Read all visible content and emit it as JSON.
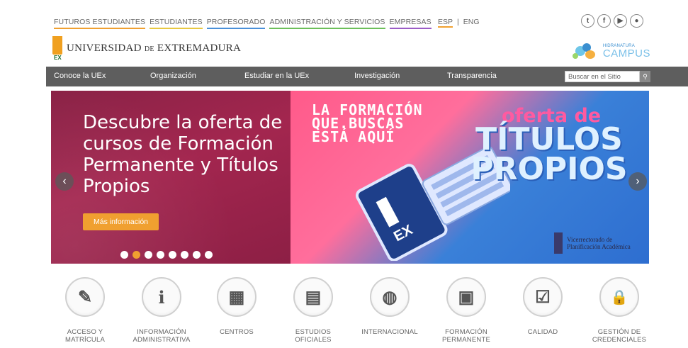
{
  "top_links": [
    {
      "label": "FUTUROS ESTUDIANTES",
      "accent": "#f0a030"
    },
    {
      "label": "ESTUDIANTES",
      "accent": "#e8c840"
    },
    {
      "label": "PROFESORADO",
      "accent": "#4a90d9"
    },
    {
      "label": "ADMINISTRACIÓN Y SERVICIOS",
      "accent": "#6cbf5a"
    },
    {
      "label": "EMPRESAS",
      "accent": "#9a5cc6"
    }
  ],
  "language": {
    "esp": "ESP",
    "separator": "|",
    "eng": "ENG"
  },
  "social": [
    {
      "icon": "twitter-icon",
      "glyph": "t"
    },
    {
      "icon": "facebook-icon",
      "glyph": "f"
    },
    {
      "icon": "youtube-icon",
      "glyph": "▶"
    },
    {
      "icon": "flickr-icon",
      "glyph": "●"
    }
  ],
  "logo": {
    "name_main": "UNIVERSIDAD",
    "name_de": "DE",
    "name_last": "EXTREMADURA",
    "mark_text": "EX"
  },
  "campus": {
    "line1": "HIDRANATURA",
    "line2": "CAMPUS"
  },
  "nav": {
    "items": [
      "Conoce la UEx",
      "Organización",
      "Estudiar en la UEx",
      "Investigación",
      "Transparencia"
    ],
    "search_placeholder": "Buscar en el Sitio"
  },
  "slide": {
    "headline": "Descubre la oferta de cursos de Formación Permanente y Títulos Propios",
    "button": "Más información",
    "dots_total": 8,
    "dots_active": 1,
    "right_text_1": "LA FORMACIÓN",
    "right_text_2": "QUE.BUSCAS",
    "right_text_3": "ESTÁ AQUÍ",
    "oferta": "oferta de",
    "titulos_1": "TÍTULOS",
    "titulos_2": "PROPIOS",
    "vice_1": "Vicerrectorado de",
    "vice_2": "Planificación Académica"
  },
  "quick_links": [
    {
      "icon": "edit-icon",
      "glyph": "✎",
      "label1": "ACCESO Y",
      "label2": "MATRÍCULA"
    },
    {
      "icon": "info-icon",
      "glyph": "i",
      "label1": "INFORMACIÓN",
      "label2": "ADMINISTRATIVA"
    },
    {
      "icon": "building-icon",
      "glyph": "▦",
      "label1": "CENTROS",
      "label2": ""
    },
    {
      "icon": "book-icon",
      "glyph": "▤",
      "label1": "ESTUDIOS",
      "label2": "OFICIALES"
    },
    {
      "icon": "globe-icon",
      "glyph": "◍",
      "label1": "INTERNACIONAL",
      "label2": ""
    },
    {
      "icon": "monitor-icon",
      "glyph": "▣",
      "label1": "FORMACIÓN",
      "label2": "PERMANENTE"
    },
    {
      "icon": "checkbox-icon",
      "glyph": "☑",
      "label1": "CALIDAD",
      "label2": ""
    },
    {
      "icon": "lock-icon",
      "glyph": "🔒",
      "label1": "GESTIÓN DE",
      "label2": "CREDENCIALES"
    }
  ]
}
